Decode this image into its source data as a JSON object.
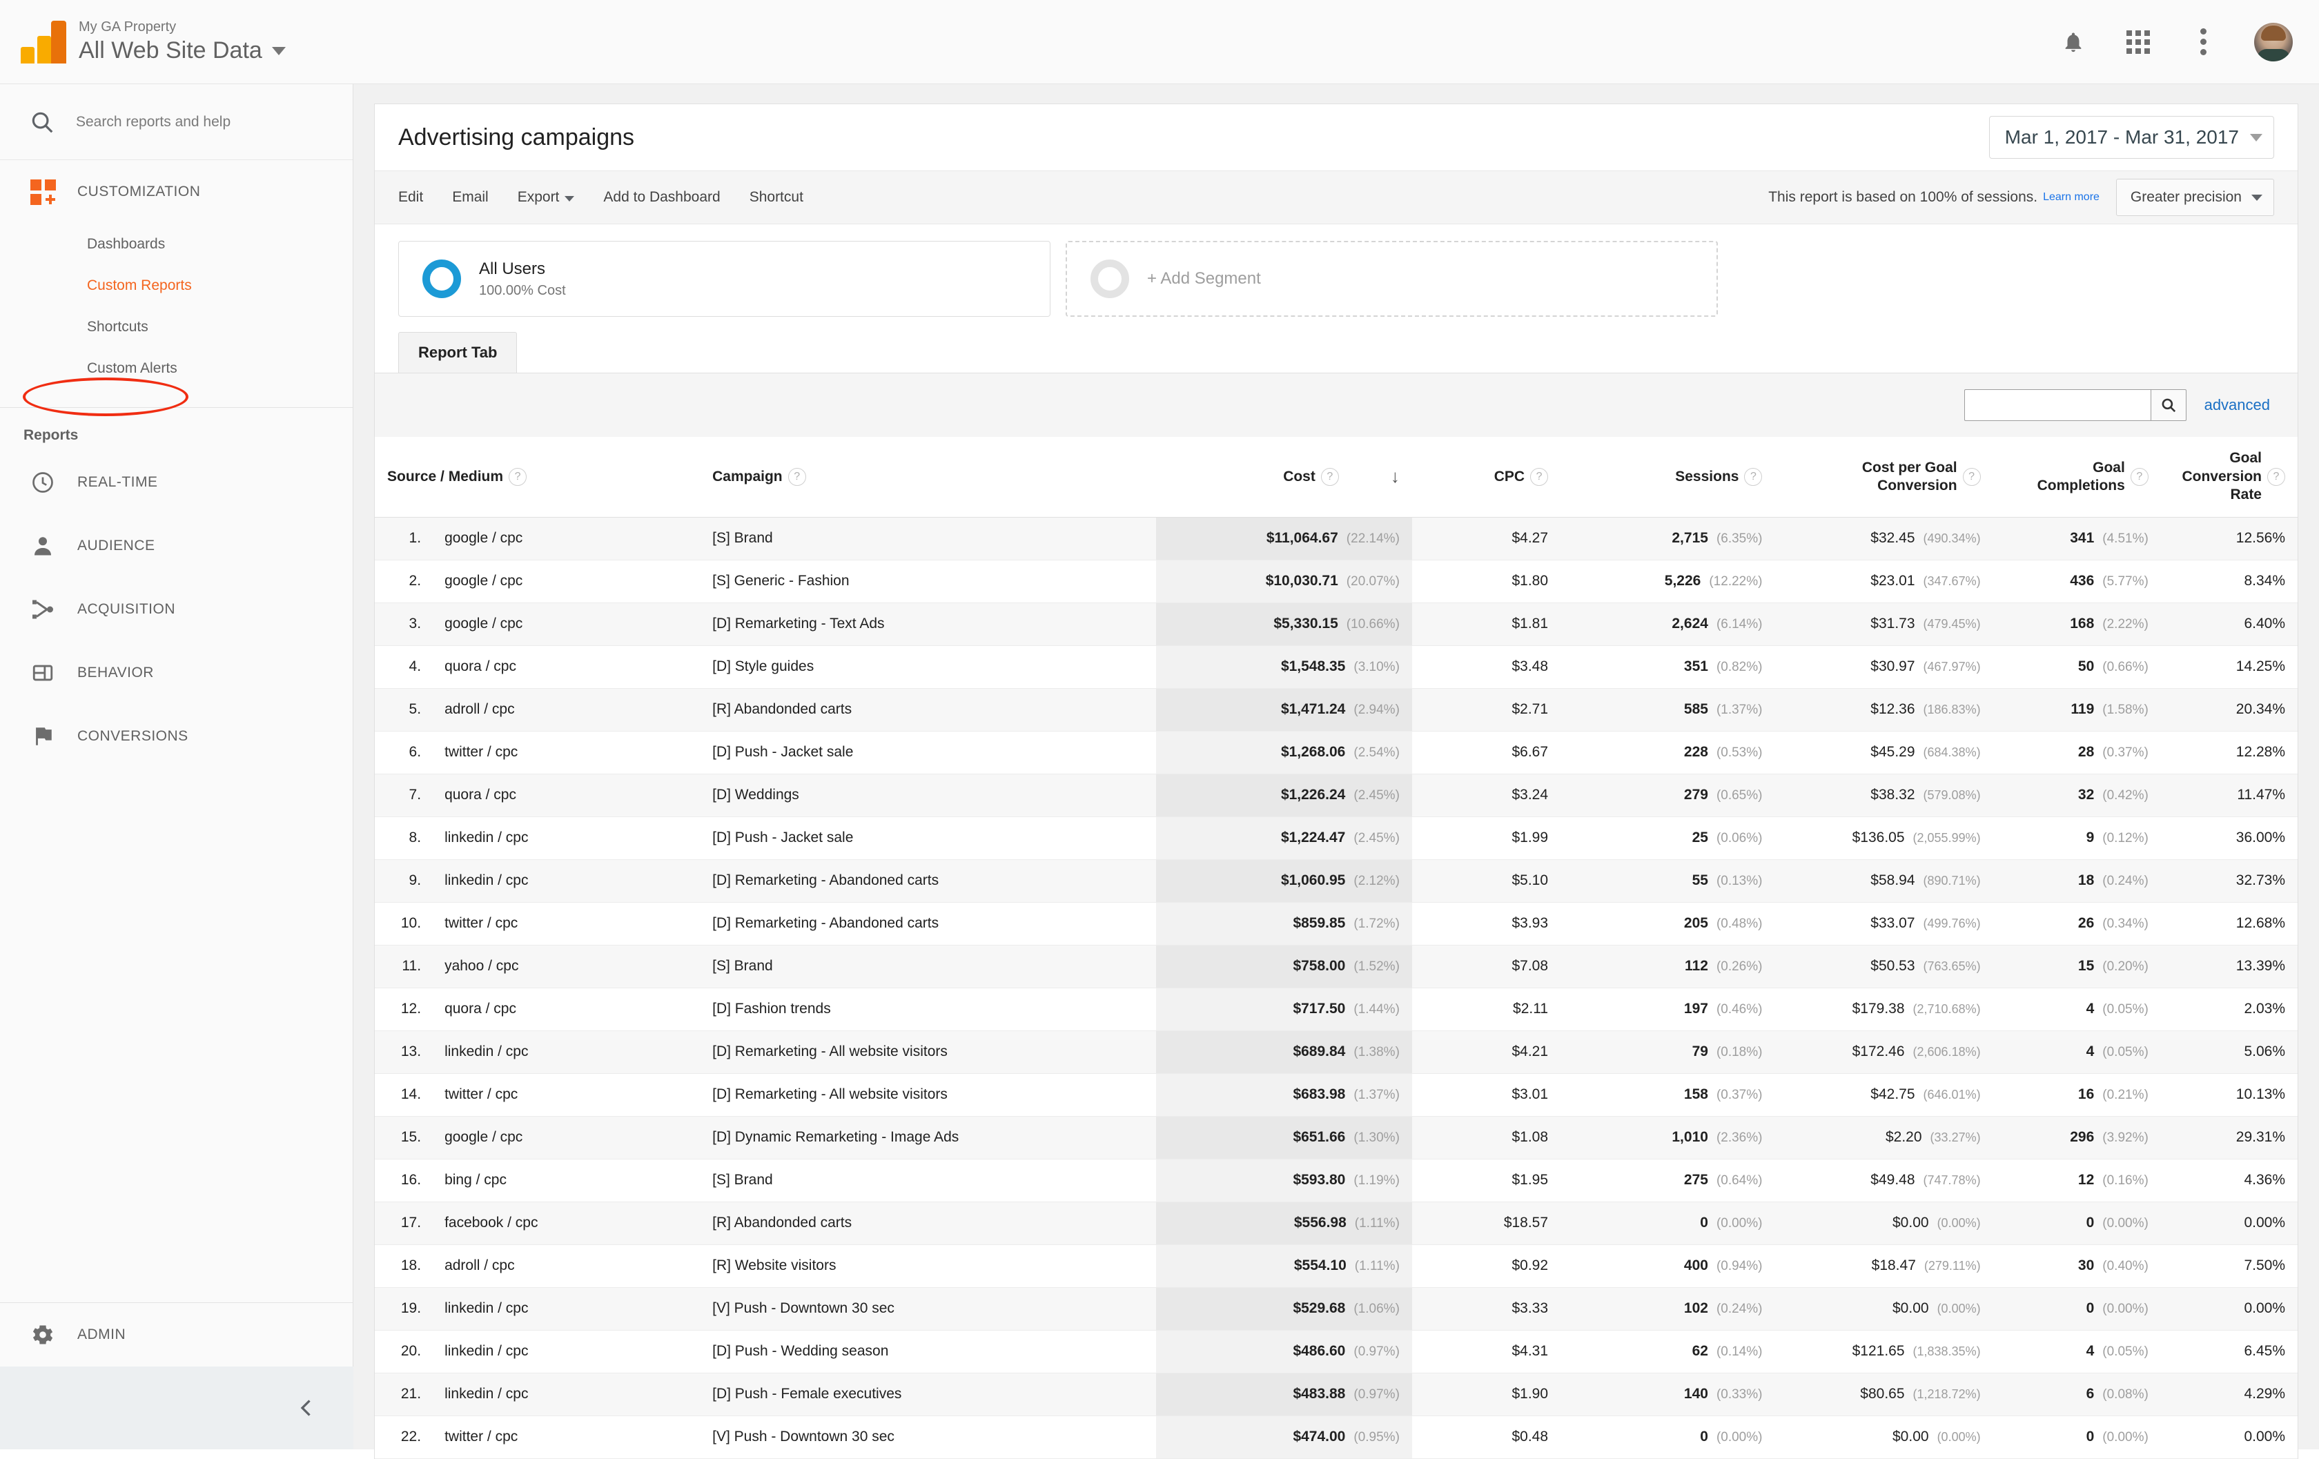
{
  "topbar": {
    "property_name": "My GA Property",
    "view_name": "All Web Site Data",
    "icons": [
      "bell-icon",
      "apps-grid-icon",
      "more-vert-icon",
      "avatar"
    ]
  },
  "sidebar": {
    "search_placeholder": "Search reports and help",
    "customization": {
      "label": "CUSTOMIZATION",
      "items": [
        {
          "label": "Dashboards",
          "active": false
        },
        {
          "label": "Custom Reports",
          "active": true
        },
        {
          "label": "Shortcuts",
          "active": false
        },
        {
          "label": "Custom Alerts",
          "active": false
        }
      ]
    },
    "reports_label": "Reports",
    "reports": [
      {
        "label": "REAL-TIME",
        "icon": "clock-icon"
      },
      {
        "label": "AUDIENCE",
        "icon": "person-icon"
      },
      {
        "label": "ACQUISITION",
        "icon": "share-nodes-icon"
      },
      {
        "label": "BEHAVIOR",
        "icon": "layout-icon"
      },
      {
        "label": "CONVERSIONS",
        "icon": "flag-icon"
      }
    ],
    "admin_label": "ADMIN",
    "highlight_color": "#f02d12",
    "active_color": "#f4651f"
  },
  "header": {
    "page_title": "Advertising campaigns",
    "date_range": "Mar 1, 2017 - Mar 31, 2017"
  },
  "toolbar": {
    "links": [
      "Edit",
      "Email",
      "Export",
      "Add to Dashboard",
      "Shortcut"
    ],
    "sampling_text": "This report is based on 100% of sessions.",
    "learn_more": "Learn more",
    "precision": "Greater precision"
  },
  "segments": {
    "all_users_name": "All Users",
    "all_users_sub": "100.00% Cost",
    "add_segment_label": "+ Add Segment"
  },
  "tabs": {
    "report_tab": "Report Tab"
  },
  "table_search": {
    "value": "",
    "advanced_label": "advanced"
  },
  "chart_data": {
    "type": "table",
    "title": "Advertising campaigns",
    "columns": [
      "Source / Medium",
      "Campaign",
      "Cost",
      "CPC",
      "Sessions",
      "Cost per Goal Conversion",
      "Goal Completions",
      "Goal Conversion Rate"
    ],
    "sort_column": "Cost",
    "sort_direction": "desc",
    "rows": [
      {
        "i": "1.",
        "source": "google / cpc",
        "campaign": "[S] Brand",
        "cost": "$11,064.67",
        "cost_pct": "(22.14%)",
        "cpc": "$4.27",
        "sessions": "2,715",
        "sessions_pct": "(6.35%)",
        "cpg": "$32.45",
        "cpg_pct": "(490.34%)",
        "goals": "341",
        "goals_pct": "(4.51%)",
        "gcr": "12.56%"
      },
      {
        "i": "2.",
        "source": "google / cpc",
        "campaign": "[S] Generic - Fashion",
        "cost": "$10,030.71",
        "cost_pct": "(20.07%)",
        "cpc": "$1.80",
        "sessions": "5,226",
        "sessions_pct": "(12.22%)",
        "cpg": "$23.01",
        "cpg_pct": "(347.67%)",
        "goals": "436",
        "goals_pct": "(5.77%)",
        "gcr": "8.34%"
      },
      {
        "i": "3.",
        "source": "google / cpc",
        "campaign": "[D] Remarketing - Text Ads",
        "cost": "$5,330.15",
        "cost_pct": "(10.66%)",
        "cpc": "$1.81",
        "sessions": "2,624",
        "sessions_pct": "(6.14%)",
        "cpg": "$31.73",
        "cpg_pct": "(479.45%)",
        "goals": "168",
        "goals_pct": "(2.22%)",
        "gcr": "6.40%"
      },
      {
        "i": "4.",
        "source": "quora / cpc",
        "campaign": "[D] Style guides",
        "cost": "$1,548.35",
        "cost_pct": "(3.10%)",
        "cpc": "$3.48",
        "sessions": "351",
        "sessions_pct": "(0.82%)",
        "cpg": "$30.97",
        "cpg_pct": "(467.97%)",
        "goals": "50",
        "goals_pct": "(0.66%)",
        "gcr": "14.25%"
      },
      {
        "i": "5.",
        "source": "adroll / cpc",
        "campaign": "[R] Abandonded carts",
        "cost": "$1,471.24",
        "cost_pct": "(2.94%)",
        "cpc": "$2.71",
        "sessions": "585",
        "sessions_pct": "(1.37%)",
        "cpg": "$12.36",
        "cpg_pct": "(186.83%)",
        "goals": "119",
        "goals_pct": "(1.58%)",
        "gcr": "20.34%"
      },
      {
        "i": "6.",
        "source": "twitter / cpc",
        "campaign": "[D] Push - Jacket sale",
        "cost": "$1,268.06",
        "cost_pct": "(2.54%)",
        "cpc": "$6.67",
        "sessions": "228",
        "sessions_pct": "(0.53%)",
        "cpg": "$45.29",
        "cpg_pct": "(684.38%)",
        "goals": "28",
        "goals_pct": "(0.37%)",
        "gcr": "12.28%"
      },
      {
        "i": "7.",
        "source": "quora / cpc",
        "campaign": "[D] Weddings",
        "cost": "$1,226.24",
        "cost_pct": "(2.45%)",
        "cpc": "$3.24",
        "sessions": "279",
        "sessions_pct": "(0.65%)",
        "cpg": "$38.32",
        "cpg_pct": "(579.08%)",
        "goals": "32",
        "goals_pct": "(0.42%)",
        "gcr": "11.47%"
      },
      {
        "i": "8.",
        "source": "linkedin / cpc",
        "campaign": "[D] Push - Jacket sale",
        "cost": "$1,224.47",
        "cost_pct": "(2.45%)",
        "cpc": "$1.99",
        "sessions": "25",
        "sessions_pct": "(0.06%)",
        "cpg": "$136.05",
        "cpg_pct": "(2,055.99%)",
        "goals": "9",
        "goals_pct": "(0.12%)",
        "gcr": "36.00%"
      },
      {
        "i": "9.",
        "source": "linkedin / cpc",
        "campaign": "[D] Remarketing - Abandoned carts",
        "cost": "$1,060.95",
        "cost_pct": "(2.12%)",
        "cpc": "$5.10",
        "sessions": "55",
        "sessions_pct": "(0.13%)",
        "cpg": "$58.94",
        "cpg_pct": "(890.71%)",
        "goals": "18",
        "goals_pct": "(0.24%)",
        "gcr": "32.73%"
      },
      {
        "i": "10.",
        "source": "twitter / cpc",
        "campaign": "[D] Remarketing - Abandoned carts",
        "cost": "$859.85",
        "cost_pct": "(1.72%)",
        "cpc": "$3.93",
        "sessions": "205",
        "sessions_pct": "(0.48%)",
        "cpg": "$33.07",
        "cpg_pct": "(499.76%)",
        "goals": "26",
        "goals_pct": "(0.34%)",
        "gcr": "12.68%"
      },
      {
        "i": "11.",
        "source": "yahoo / cpc",
        "campaign": "[S] Brand",
        "cost": "$758.00",
        "cost_pct": "(1.52%)",
        "cpc": "$7.08",
        "sessions": "112",
        "sessions_pct": "(0.26%)",
        "cpg": "$50.53",
        "cpg_pct": "(763.65%)",
        "goals": "15",
        "goals_pct": "(0.20%)",
        "gcr": "13.39%"
      },
      {
        "i": "12.",
        "source": "quora / cpc",
        "campaign": "[D] Fashion trends",
        "cost": "$717.50",
        "cost_pct": "(1.44%)",
        "cpc": "$2.11",
        "sessions": "197",
        "sessions_pct": "(0.46%)",
        "cpg": "$179.38",
        "cpg_pct": "(2,710.68%)",
        "goals": "4",
        "goals_pct": "(0.05%)",
        "gcr": "2.03%"
      },
      {
        "i": "13.",
        "source": "linkedin / cpc",
        "campaign": "[D] Remarketing - All website visitors",
        "cost": "$689.84",
        "cost_pct": "(1.38%)",
        "cpc": "$4.21",
        "sessions": "79",
        "sessions_pct": "(0.18%)",
        "cpg": "$172.46",
        "cpg_pct": "(2,606.18%)",
        "goals": "4",
        "goals_pct": "(0.05%)",
        "gcr": "5.06%"
      },
      {
        "i": "14.",
        "source": "twitter / cpc",
        "campaign": "[D] Remarketing - All website visitors",
        "cost": "$683.98",
        "cost_pct": "(1.37%)",
        "cpc": "$3.01",
        "sessions": "158",
        "sessions_pct": "(0.37%)",
        "cpg": "$42.75",
        "cpg_pct": "(646.01%)",
        "goals": "16",
        "goals_pct": "(0.21%)",
        "gcr": "10.13%"
      },
      {
        "i": "15.",
        "source": "google / cpc",
        "campaign": "[D] Dynamic Remarketing - Image Ads",
        "cost": "$651.66",
        "cost_pct": "(1.30%)",
        "cpc": "$1.08",
        "sessions": "1,010",
        "sessions_pct": "(2.36%)",
        "cpg": "$2.20",
        "cpg_pct": "(33.27%)",
        "goals": "296",
        "goals_pct": "(3.92%)",
        "gcr": "29.31%"
      },
      {
        "i": "16.",
        "source": "bing / cpc",
        "campaign": "[S] Brand",
        "cost": "$593.80",
        "cost_pct": "(1.19%)",
        "cpc": "$1.95",
        "sessions": "275",
        "sessions_pct": "(0.64%)",
        "cpg": "$49.48",
        "cpg_pct": "(747.78%)",
        "goals": "12",
        "goals_pct": "(0.16%)",
        "gcr": "4.36%"
      },
      {
        "i": "17.",
        "source": "facebook / cpc",
        "campaign": "[R] Abandonded carts",
        "cost": "$556.98",
        "cost_pct": "(1.11%)",
        "cpc": "$18.57",
        "sessions": "0",
        "sessions_pct": "(0.00%)",
        "cpg": "$0.00",
        "cpg_pct": "(0.00%)",
        "goals": "0",
        "goals_pct": "(0.00%)",
        "gcr": "0.00%"
      },
      {
        "i": "18.",
        "source": "adroll / cpc",
        "campaign": "[R] Website visitors",
        "cost": "$554.10",
        "cost_pct": "(1.11%)",
        "cpc": "$0.92",
        "sessions": "400",
        "sessions_pct": "(0.94%)",
        "cpg": "$18.47",
        "cpg_pct": "(279.11%)",
        "goals": "30",
        "goals_pct": "(0.40%)",
        "gcr": "7.50%"
      },
      {
        "i": "19.",
        "source": "linkedin / cpc",
        "campaign": "[V] Push - Downtown 30 sec",
        "cost": "$529.68",
        "cost_pct": "(1.06%)",
        "cpc": "$3.33",
        "sessions": "102",
        "sessions_pct": "(0.24%)",
        "cpg": "$0.00",
        "cpg_pct": "(0.00%)",
        "goals": "0",
        "goals_pct": "(0.00%)",
        "gcr": "0.00%"
      },
      {
        "i": "20.",
        "source": "linkedin / cpc",
        "campaign": "[D] Push - Wedding season",
        "cost": "$486.60",
        "cost_pct": "(0.97%)",
        "cpc": "$4.31",
        "sessions": "62",
        "sessions_pct": "(0.14%)",
        "cpg": "$121.65",
        "cpg_pct": "(1,838.35%)",
        "goals": "4",
        "goals_pct": "(0.05%)",
        "gcr": "6.45%"
      },
      {
        "i": "21.",
        "source": "linkedin / cpc",
        "campaign": "[D] Push - Female executives",
        "cost": "$483.88",
        "cost_pct": "(0.97%)",
        "cpc": "$1.90",
        "sessions": "140",
        "sessions_pct": "(0.33%)",
        "cpg": "$80.65",
        "cpg_pct": "(1,218.72%)",
        "goals": "6",
        "goals_pct": "(0.08%)",
        "gcr": "4.29%"
      },
      {
        "i": "22.",
        "source": "twitter / cpc",
        "campaign": "[V] Push - Downtown 30 sec",
        "cost": "$474.00",
        "cost_pct": "(0.95%)",
        "cpc": "$0.48",
        "sessions": "0",
        "sessions_pct": "(0.00%)",
        "cpg": "$0.00",
        "cpg_pct": "(0.00%)",
        "goals": "0",
        "goals_pct": "(0.00%)",
        "gcr": "0.00%"
      }
    ]
  }
}
